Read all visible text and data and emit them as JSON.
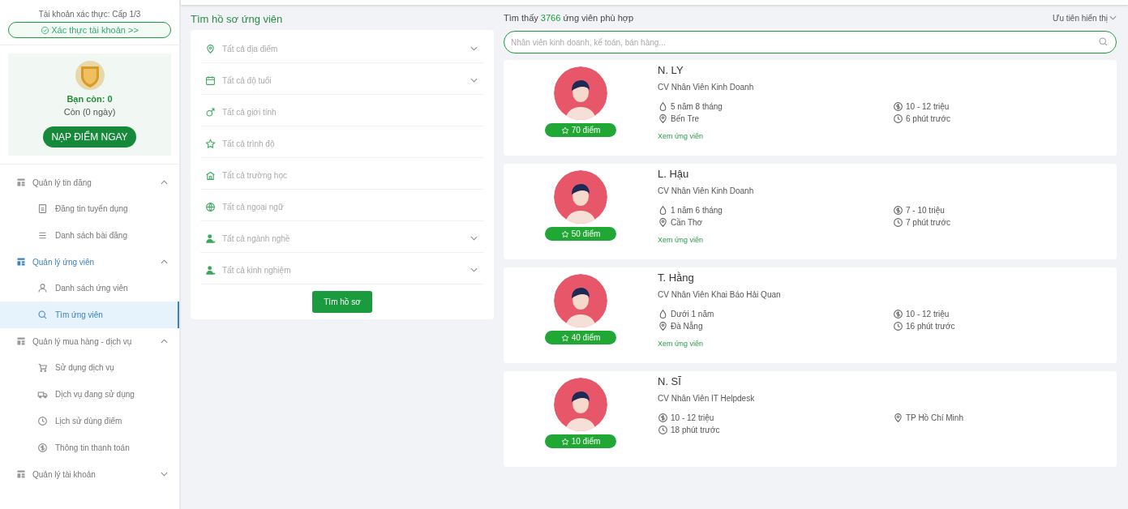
{
  "sidebar": {
    "verify_label": "Tài khoản xác thực: Cấp 1/3",
    "verify_button": "Xác thực tài khoản >>",
    "points": {
      "balance": "Bạn còn: 0",
      "remaining": "Còn (0 ngày)",
      "button": "NẠP ĐIỂM NGAY"
    },
    "groups": [
      {
        "label": "Quản lý tin đăng",
        "active": false,
        "expanded": true,
        "children": [
          {
            "label": "Đăng tin tuyển dụng",
            "kind": "doc",
            "selected": false
          },
          {
            "label": "Danh sách bài đăng",
            "kind": "list",
            "selected": false
          }
        ]
      },
      {
        "label": "Quản lý ứng viên",
        "active": true,
        "expanded": true,
        "children": [
          {
            "label": "Danh sách ứng viên",
            "kind": "user",
            "selected": false
          },
          {
            "label": "Tìm ứng viên",
            "kind": "search",
            "selected": true
          }
        ]
      },
      {
        "label": "Quản lý mua hàng - dịch vụ",
        "active": false,
        "expanded": true,
        "children": [
          {
            "label": "Sử dụng dịch vụ",
            "kind": "cart",
            "selected": false
          },
          {
            "label": "Dịch vụ đang sử dụng",
            "kind": "truck",
            "selected": false
          },
          {
            "label": "Lịch sử dùng điểm",
            "kind": "clock",
            "selected": false
          },
          {
            "label": "Thông tin thanh toán",
            "kind": "coin",
            "selected": false
          }
        ]
      },
      {
        "label": "Quản lý tài khoản",
        "active": false,
        "expanded": false
      }
    ]
  },
  "filter": {
    "title": "Tìm hồ sơ ứng viên",
    "fields": [
      {
        "placeholder": "Tất cả địa điểm",
        "kind": "pin",
        "dropdown": true
      },
      {
        "placeholder": "Tất cả độ tuổi",
        "kind": "calendar",
        "dropdown": true
      },
      {
        "placeholder": "Tất cả giới tính",
        "kind": "gender",
        "dropdown": false
      },
      {
        "placeholder": "Tất cả trình độ",
        "kind": "star",
        "dropdown": false
      },
      {
        "placeholder": "Tất cả trường học",
        "kind": "school",
        "dropdown": false
      },
      {
        "placeholder": "Tất cả ngoại ngữ",
        "kind": "globe",
        "dropdown": false
      },
      {
        "placeholder": "Tất cả ngành nghề",
        "kind": "person",
        "dropdown": true
      },
      {
        "placeholder": "Tất cả kinh nghiệm",
        "kind": "person",
        "dropdown": true
      }
    ],
    "button": "Tìm hồ sơ"
  },
  "results": {
    "found_prefix": "Tìm thấy",
    "found_count": "3766",
    "found_suffix": "ứng viên phù hợp",
    "sort": "Ưu tiên hiển thị",
    "search_placeholder": "Nhân viên kinh doanh, kế toán, bán hàng...",
    "candidates": [
      {
        "name": "N. LY",
        "title": "CV Nhân Viên Kinh Doanh",
        "points": "70 điểm",
        "left": [
          {
            "kind": "exp",
            "text": "5 năm 8 tháng"
          },
          {
            "kind": "pin",
            "text": "Bến Tre"
          }
        ],
        "right": [
          {
            "kind": "money",
            "text": "10 - 12 triệu"
          },
          {
            "kind": "clock",
            "text": "6 phút trước"
          }
        ],
        "link": "Xem ứng viên"
      },
      {
        "name": "L. Hậu",
        "title": "CV Nhân Viên Kinh Doanh",
        "points": "50 điểm",
        "left": [
          {
            "kind": "exp",
            "text": "1 năm 6 tháng"
          },
          {
            "kind": "pin",
            "text": "Cần Thơ"
          }
        ],
        "right": [
          {
            "kind": "money",
            "text": "7 - 10 triệu"
          },
          {
            "kind": "clock",
            "text": "7 phút trước"
          }
        ],
        "link": "Xem ứng viên"
      },
      {
        "name": "T. Hằng",
        "title": "CV Nhân Viên Khai Báo Hải Quan",
        "points": "40 điểm",
        "left": [
          {
            "kind": "exp",
            "text": "Dưới 1 năm"
          },
          {
            "kind": "pin",
            "text": "Đà Nẵng"
          }
        ],
        "right": [
          {
            "kind": "money",
            "text": "10 - 12 triệu"
          },
          {
            "kind": "clock",
            "text": "16 phút trước"
          }
        ],
        "link": "Xem ứng viên"
      },
      {
        "name": "N. SĨ",
        "title": "CV Nhân Viên IT Helpdesk",
        "points": "10 điểm",
        "left": [
          {
            "kind": "money",
            "text": "10 - 12 triệu"
          },
          {
            "kind": "clock",
            "text": "18 phút trước"
          }
        ],
        "right": [
          {
            "kind": "pin",
            "text": "TP Hồ Chí Minh"
          }
        ]
      }
    ]
  }
}
